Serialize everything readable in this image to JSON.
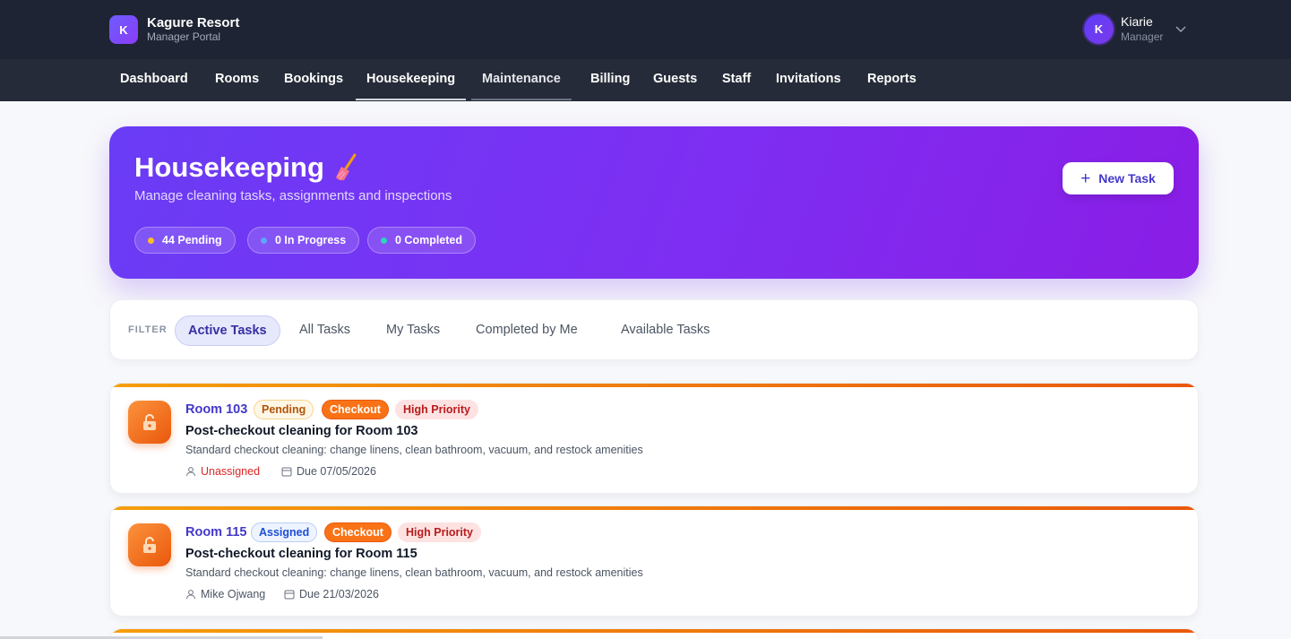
{
  "app": {
    "logo_letter": "K",
    "name": "Kagure Resort",
    "subtitle": "Manager Portal"
  },
  "user": {
    "initial": "K",
    "name": "Kiarie",
    "role": "Manager",
    "menu_icon": "chevron-down-icon"
  },
  "nav": {
    "items": [
      "Dashboard",
      "Rooms",
      "Bookings",
      "Housekeeping",
      "Maintenance",
      "Billing",
      "Guests",
      "Staff",
      "Invitations",
      "Reports"
    ],
    "active": "Housekeeping",
    "hovered": "Maintenance"
  },
  "hero": {
    "title": "Housekeeping",
    "title_icon": "broom-icon",
    "subtitle": "Manage cleaning tasks, assignments and inspections",
    "stats": [
      {
        "label": "44 Pending",
        "dot_color": "#fbbf24"
      },
      {
        "label": "0 In Progress",
        "dot_color": "#60a5fa"
      },
      {
        "label": "0 Completed",
        "dot_color": "#2dd4bf"
      }
    ],
    "new_task_label": "New Task"
  },
  "filter": {
    "label": "FILTER",
    "tabs": [
      "Active Tasks",
      "All Tasks",
      "My Tasks",
      "Completed by Me",
      "Available Tasks"
    ],
    "active": "Active Tasks"
  },
  "tasks": [
    {
      "room": "Room 103",
      "status": "Pending",
      "type": "Checkout",
      "priority": "High Priority",
      "title": "Post-checkout cleaning for Room 103",
      "description": "Standard checkout cleaning: change linens, clean bathroom, vacuum, and restock amenities",
      "assignee": "Unassigned",
      "due": "Due 07/05/2026"
    },
    {
      "room": "Room 115",
      "status": "Assigned",
      "type": "Checkout",
      "priority": "High Priority",
      "title": "Post-checkout cleaning for Room 115",
      "description": "Standard checkout cleaning: change linens, clean bathroom, vacuum, and restock amenities",
      "assignee": "Mike Ojwang",
      "due": "Due 21/03/2026"
    }
  ],
  "colors": {
    "accent": "#4338ca",
    "hero_gradient_start": "#6a3cf5",
    "hero_gradient_end": "#8a1de6",
    "card_stripe": "#ea580c"
  }
}
